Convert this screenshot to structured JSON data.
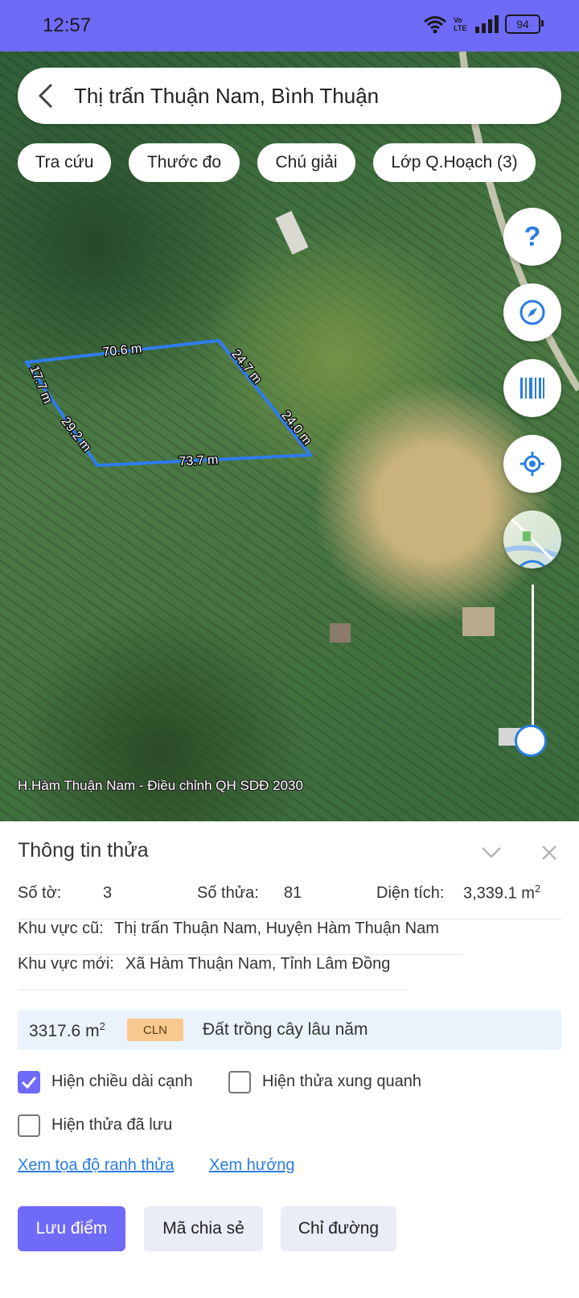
{
  "status_bar": {
    "time": "12:57",
    "network_badge": "Vo LTE",
    "battery": "94"
  },
  "search": {
    "title": "Thị trấn Thuận Nam, Bình Thuận"
  },
  "chips": [
    "Tra cứu",
    "Thước đo",
    "Chú giải",
    "Lớp Q.Hoạch (3)"
  ],
  "fabs": {
    "help_symbol": "?"
  },
  "parcel_edges": {
    "top": "70.6 m",
    "right_upper": "24.7 m",
    "right_lower": "24.0 m",
    "bottom": "73.7 m",
    "left_lower": "29.2 m",
    "left_upper": "17.7 m"
  },
  "map_caption": "H.Hàm Thuận Nam - Điều chỉnh QH SDĐ 2030",
  "panel": {
    "title": "Thông tin thửa",
    "so_to_label": "Số tờ:",
    "so_to_value": "3",
    "so_thua_label": "Số thửa:",
    "so_thua_value": "81",
    "dien_tich_label": "Diện tích:",
    "dien_tich_value": "3,339.1 m",
    "superscript": "2",
    "khu_vuc_cu_label": "Khu vực cũ:",
    "khu_vuc_cu_value": "Thị trấn Thuận Nam, Huyện Hàm Thuận Nam",
    "khu_vuc_moi_label": "Khu vực mới:",
    "khu_vuc_moi_value": "Xã Hàm Thuận Nam, Tỉnh Lâm Đồng",
    "land_area": "3317.6 m",
    "land_code": "CLN",
    "land_desc": "Đất trồng cây lâu năm",
    "checkboxes": [
      {
        "label": "Hiện chiều dài cạnh",
        "checked": true
      },
      {
        "label": "Hiện thửa xung quanh",
        "checked": false
      },
      {
        "label": "Hiện thửa đã lưu",
        "checked": false
      }
    ],
    "links": [
      "Xem tọa độ ranh thửa",
      "Xem hướng"
    ],
    "buttons": [
      "Lưu điểm",
      "Mã chia sẻ",
      "Chỉ đường"
    ]
  },
  "colors": {
    "accent": "#6f6af8",
    "link": "#2a7de1",
    "parcel_outline": "#2f7cf0",
    "code_badge": "#f8c98f"
  }
}
